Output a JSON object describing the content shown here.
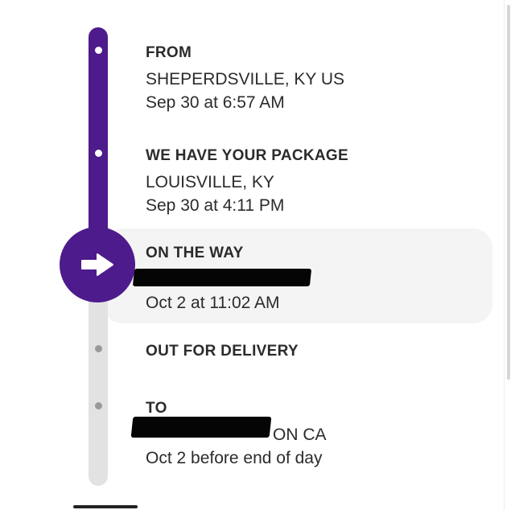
{
  "timeline": {
    "colors": {
      "completed": "#4d1b8c",
      "pending": "#e2e2e2",
      "highlight_background": "#f4f4f4"
    },
    "current_marker_icon": "arrow-right-icon",
    "steps": [
      {
        "title": "FROM",
        "location": "SHEPERDSVILLE, KY US",
        "time": "Sep 30 at 6:57 AM",
        "status": "completed"
      },
      {
        "title": "WE HAVE YOUR PACKAGE",
        "location": "LOUISVILLE, KY",
        "time": "Sep 30 at 4:11 PM",
        "status": "completed"
      },
      {
        "title": "ON THE WAY",
        "location": "",
        "time": "Oct 2 at 11:02 AM",
        "status": "current"
      },
      {
        "title": "OUT FOR DELIVERY",
        "status": "pending"
      },
      {
        "title": "TO",
        "location": "ON CA",
        "time": "Oct 2 before end of day",
        "status": "pending"
      }
    ]
  }
}
